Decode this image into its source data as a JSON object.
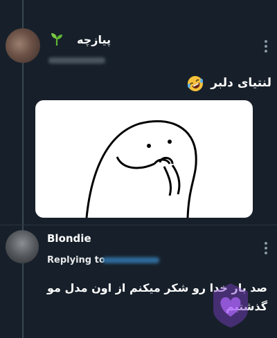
{
  "tweet_1": {
    "display_name": "پیازچه",
    "name_emoji_icon": "sprout-icon",
    "handle": "",
    "text": "لنتیای دلبر",
    "text_emoji_icon": "rolling-on-floor-laughing-icon",
    "more_icon": "more-vertical-icon",
    "media_description": "meme-blob-character-image"
  },
  "tweet_2": {
    "display_name": "Blondie",
    "replying_to_label": "Replying to",
    "replying_to_handle": "",
    "text_line_1": "صد بار خدا رو شکر میکنم از اون مدل مو",
    "text_line_2": "گذشتیم",
    "more_icon": "more-vertical-icon"
  },
  "watermark_icon": "purple-heart-shield-icon",
  "colors": {
    "background": "#17202a",
    "text": "#ffffff",
    "muted": "#8b98a5",
    "thread_line": "#3a4650",
    "link_blue": "#1d9bf0",
    "watermark_purple": "#7b3fc4"
  }
}
